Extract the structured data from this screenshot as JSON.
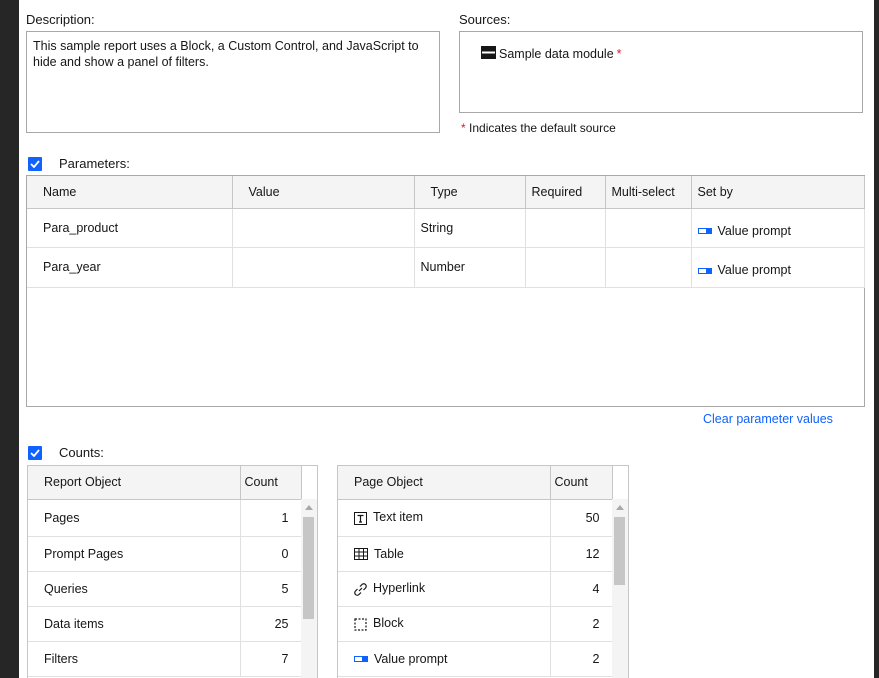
{
  "description": {
    "label": "Description:",
    "text": "This sample report uses a Block, a Custom Control, and JavaScript to hide and show a panel of filters."
  },
  "sources": {
    "label": "Sources:",
    "item": "Sample data module",
    "required_mark": "*",
    "note_mark": "*",
    "note": "Indicates the default source"
  },
  "parameters": {
    "label": "Parameters:",
    "columns": [
      "Name",
      "Value",
      "Type",
      "Required",
      "Multi-select",
      "Set by"
    ],
    "rows": [
      {
        "name": "Para_product",
        "value": "",
        "type": "String",
        "required": "",
        "multi": "",
        "set_by": "Value prompt"
      },
      {
        "name": "Para_year",
        "value": "",
        "type": "Number",
        "required": "",
        "multi": "",
        "set_by": "Value prompt"
      }
    ],
    "clear_link": "Clear parameter values"
  },
  "counts": {
    "label": "Counts:",
    "report_columns": [
      "Report Object",
      "Count"
    ],
    "report_rows": [
      {
        "label": "Pages",
        "count": "1"
      },
      {
        "label": "Prompt Pages",
        "count": "0"
      },
      {
        "label": "Queries",
        "count": "5"
      },
      {
        "label": "Data items",
        "count": "25"
      },
      {
        "label": "Filters",
        "count": "7"
      }
    ],
    "page_columns": [
      "Page Object",
      "Count"
    ],
    "page_rows": [
      {
        "icon": "text-item-icon",
        "label": "Text item",
        "count": "50"
      },
      {
        "icon": "table-icon",
        "label": "Table",
        "count": "12"
      },
      {
        "icon": "hyperlink-icon",
        "label": "Hyperlink",
        "count": "4"
      },
      {
        "icon": "block-icon",
        "label": "Block",
        "count": "2"
      },
      {
        "icon": "value-prompt-icon",
        "label": "Value prompt",
        "count": "2"
      }
    ]
  },
  "colors": {
    "accent": "#0f62fe",
    "required": "#da1e28",
    "background": "#262626"
  }
}
